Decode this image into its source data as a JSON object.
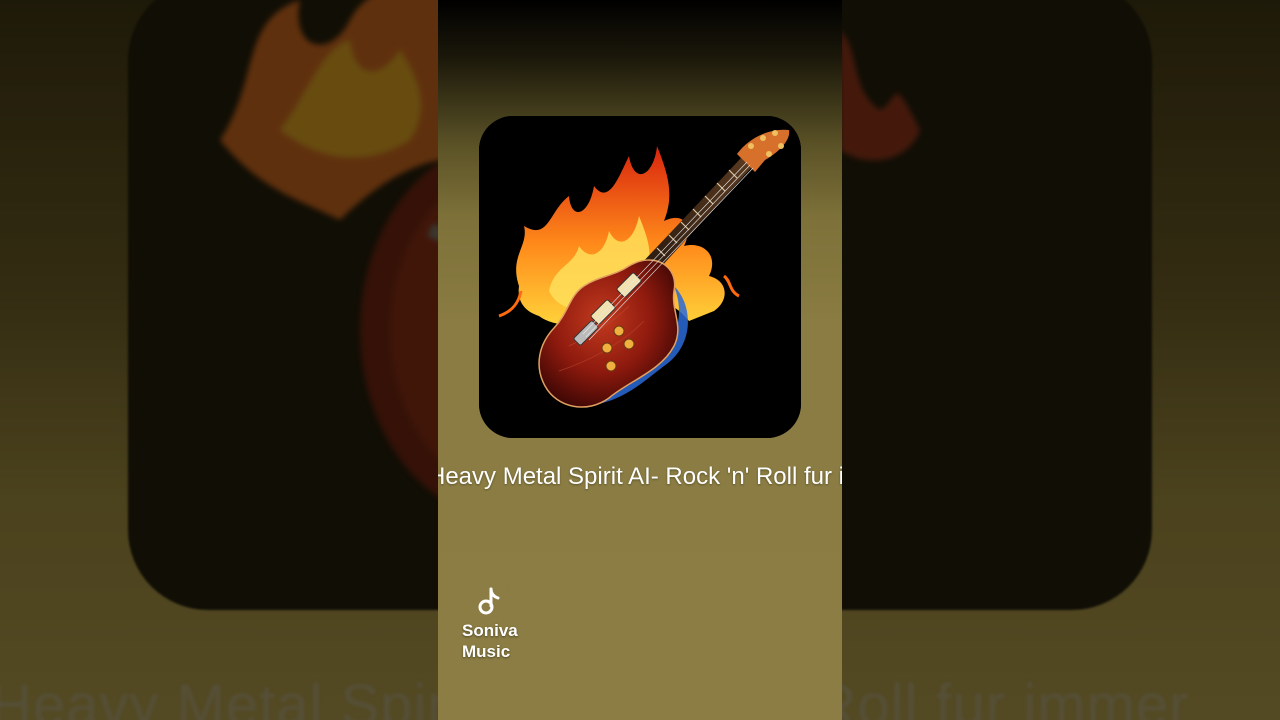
{
  "video": {
    "track_title": "Heavy Metal Spirit AI- Rock 'n' Roll fur immer",
    "cover_art": "flaming-electric-guitar",
    "background_caption": "Heavy Metal Spirit AI- Rock 'n' Roll fur immer"
  },
  "brand": {
    "name": "Soniva\nMusic",
    "icon": "music-note-logo-icon"
  },
  "colors": {
    "panel_olive": "#8b7d43",
    "flame_orange": "#ff7a1a",
    "guitar_red": "#8e1a0e",
    "text": "#ffffff"
  }
}
